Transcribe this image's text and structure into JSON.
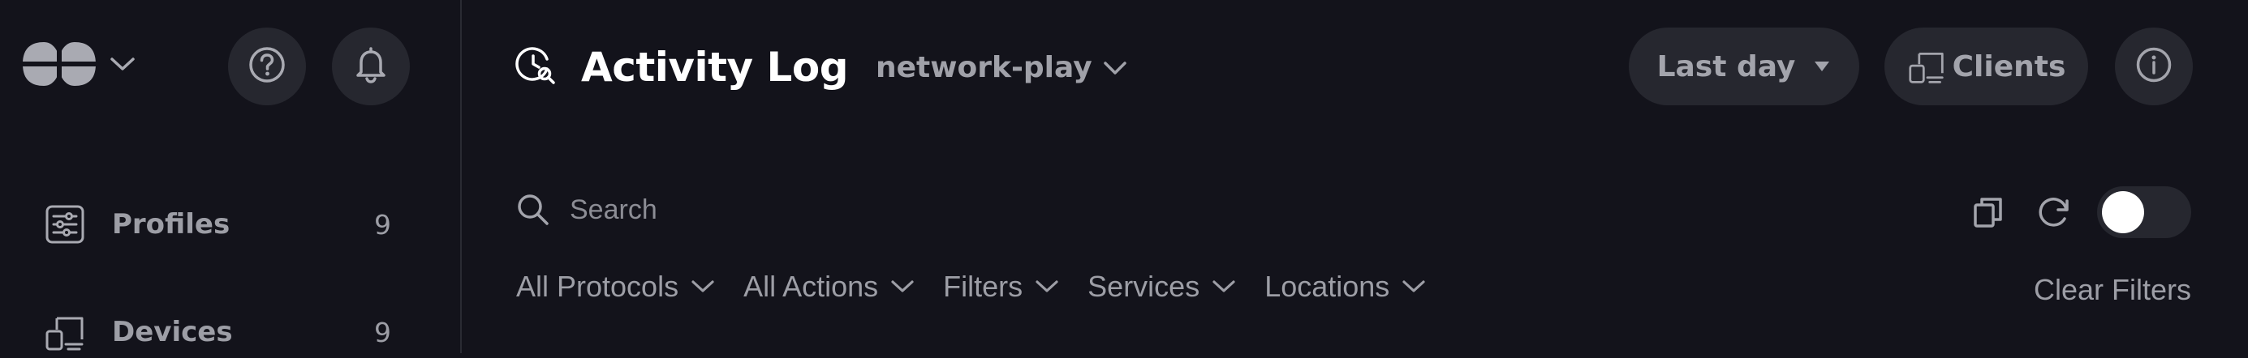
{
  "sidebar": {
    "items": [
      {
        "label": "Profiles",
        "count": "9",
        "icon": "sliders-icon"
      },
      {
        "label": "Devices",
        "count": "9",
        "icon": "devices-icon"
      }
    ]
  },
  "header": {
    "title": "Activity Log",
    "project": "network-play",
    "time_range": "Last day",
    "clients_label": "Clients"
  },
  "search": {
    "placeholder": "Search"
  },
  "filters": [
    {
      "label": "All Protocols"
    },
    {
      "label": "All Actions"
    },
    {
      "label": "Filters"
    },
    {
      "label": "Services"
    },
    {
      "label": "Locations"
    }
  ],
  "clear_filters_label": "Clear Filters",
  "colors": {
    "background": "#13131b",
    "surface": "#26272f",
    "text_primary": "#ffffff",
    "text_muted": "#9d9ea6"
  }
}
